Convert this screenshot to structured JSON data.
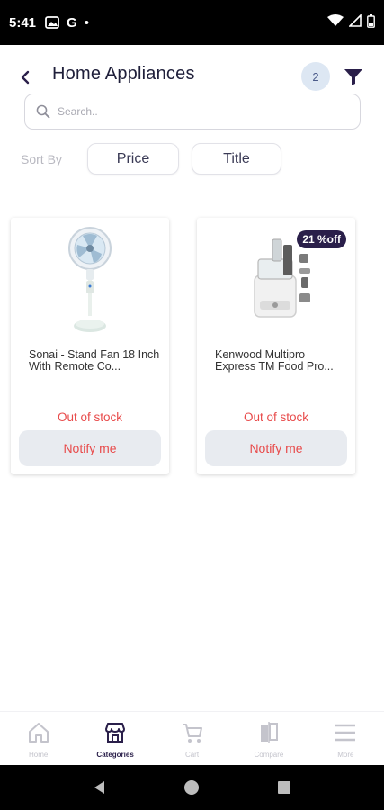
{
  "status_bar": {
    "time": "5:41",
    "carrier_glyph": "G",
    "dot": "•"
  },
  "header": {
    "title": "Home Appliances",
    "count": "2"
  },
  "search": {
    "placeholder": "Search..",
    "value": ""
  },
  "sort": {
    "label": "Sort By",
    "options": [
      "Price",
      "Title"
    ]
  },
  "products": [
    {
      "name": "Sonai - Stand Fan 18 Inch With Remote Co...",
      "stock": "Out of stock",
      "button": "Notify me",
      "discount": ""
    },
    {
      "name": "Kenwood Multipro Express TM Food Pro...",
      "stock": "Out of stock",
      "button": "Notify me",
      "discount": "21 %off"
    }
  ],
  "bottom_nav": {
    "items": [
      {
        "label": "Home",
        "icon": "home-icon"
      },
      {
        "label": "Categories",
        "icon": "store-icon"
      },
      {
        "label": "Cart",
        "icon": "cart-icon"
      },
      {
        "label": "Compare",
        "icon": "compare-icon"
      },
      {
        "label": "More",
        "icon": "menu-icon"
      }
    ],
    "active_index": 1
  },
  "colors": {
    "accent": "#2a1f4a",
    "out_of_stock": "#e84b4b",
    "badge_bg": "#dde7f3"
  }
}
